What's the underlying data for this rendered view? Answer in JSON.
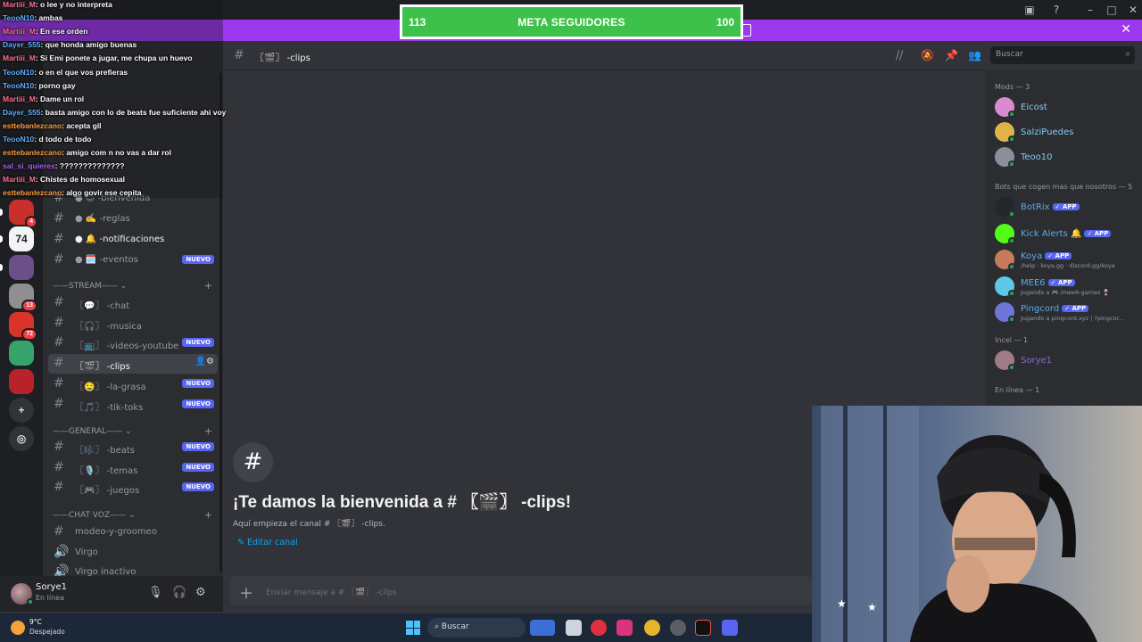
{
  "goal": {
    "left": "113",
    "label": "META SEGUIDORES",
    "right": "100"
  },
  "stream_chat": [
    {
      "user": "Martiii_M",
      "text": ": o lee y no interpreta",
      "color": "#ff6f91"
    },
    {
      "user": "TeooN10",
      "text": ": ambas",
      "color": "#5fb0ff"
    },
    {
      "user": "Martiii_M",
      "text": ": En ese orden",
      "color": "#ff6f91"
    },
    {
      "user": "Dayer_555",
      "text": ": que honda amigo buenas",
      "color": "#5fb0ff"
    },
    {
      "user": "Martiii_M",
      "text": ": Si Emi ponete a jugar, me chupa un huevo",
      "color": "#ff6f91"
    },
    {
      "user": "TeooN10",
      "text": ": o en el que vos prefieras",
      "color": "#5fb0ff"
    },
    {
      "user": "TeooN10",
      "text": ": porno gay",
      "color": "#5fb0ff"
    },
    {
      "user": "Martiii_M",
      "text": ": Dame un rol",
      "color": "#ff6f91"
    },
    {
      "user": "Dayer_555",
      "text": ": basta amigo con lo de beats fue suficiente ahi voy",
      "color": "#5fb0ff"
    },
    {
      "user": "esttebanlezcano",
      "text": ": acepta gil",
      "color": "#ff9f43"
    },
    {
      "user": "TeooN10",
      "text": ": d todo de todo",
      "color": "#5fb0ff"
    },
    {
      "user": "esttebanlezcano",
      "text": ": amigo com n no vas a dar rol",
      "color": "#ff9f43"
    },
    {
      "user": "sal_si_quieres",
      "text": ": ??????????????",
      "color": "#b35cff"
    },
    {
      "user": "Martiii_M",
      "text": ": Chistes de homosexual",
      "color": "#ff6f91"
    },
    {
      "user": "esttebanlezcano",
      "text": ": algo govir ese cepita",
      "color": "#ff9f43"
    }
  ],
  "servers": [
    {
      "label": "",
      "color": "#c9302c",
      "badge": "4"
    },
    {
      "label": "74",
      "color": "#f2f3f5",
      "badge": ""
    },
    {
      "label": "",
      "color": "#6b4e8a",
      "badge": ""
    },
    {
      "label": "",
      "color": "#8f8f8f",
      "badge": "13"
    },
    {
      "label": "",
      "color": "#d9342b",
      "badge": "72"
    },
    {
      "label": "",
      "color": "#35a36b",
      "badge": ""
    },
    {
      "label": "",
      "color": "#b8232b",
      "badge": ""
    }
  ],
  "rail_actions": {
    "add": "+",
    "discover": "◎"
  },
  "sidebar": {
    "top_channels": [
      {
        "name": "● 😊 -bienvenida",
        "nuevo": ""
      },
      {
        "name": "● ✍️ -reglas",
        "nuevo": ""
      },
      {
        "name": "● 🔔 -notificaciones",
        "nuevo": ""
      },
      {
        "name": "● 🗓️ -eventos",
        "nuevo": "NUEVO"
      }
    ],
    "cat_stream": "——STREAM——  ⌄",
    "stream_channels": [
      {
        "name": "〖💬〗 -chat",
        "nuevo": ""
      },
      {
        "name": "〖🎧〗 -musica",
        "nuevo": ""
      },
      {
        "name": "〖📺〗 -videos-youtube",
        "nuevo": "NUEVO"
      },
      {
        "name": "〖🎬〗 -clips",
        "nuevo": ""
      },
      {
        "name": "〖🤤〗 -la-grasa",
        "nuevo": "NUEVO"
      },
      {
        "name": "〖🎵〗 -tik-toks",
        "nuevo": "NUEVO"
      }
    ],
    "cat_general": "——GENERAL——  ⌄",
    "general_channels": [
      {
        "name": "〖🎼〗 -beats",
        "nuevo": "NUEVO"
      },
      {
        "name": "〖🎙️〗 -temas",
        "nuevo": "NUEVO"
      },
      {
        "name": "〖🎮〗 -juegos",
        "nuevo": "NUEVO"
      }
    ],
    "cat_voice": "——CHAT VOZ——  ⌄",
    "voice_channels": [
      {
        "name": "modeo-y-groomeo",
        "icon": "#"
      },
      {
        "name": "Virgo",
        "icon": "🔊"
      },
      {
        "name": "Virgo inactivo",
        "icon": "🔊"
      }
    ]
  },
  "user": {
    "name": "Sorye1",
    "status": "En línea"
  },
  "channel": {
    "name": "〖🎬〗 -clips",
    "welcome_title": "¡Te damos la bienvenida a # 〖🎬〗 -clips!",
    "welcome_sub": "Aquí empieza el canal # 〖🎬〗 -clips.",
    "edit": "Editar canal",
    "composer_placeholder": "Enviar mensaje a # 〖🎬〗 -clips"
  },
  "search_placeholder": "Buscar",
  "members": {
    "mods_header": "Mods — 3",
    "mods": [
      {
        "name": "Eicost",
        "color": "#85c9f2",
        "av": "#d98ad0"
      },
      {
        "name": "SalziPuedes",
        "color": "#85c9f2",
        "av": "#e0b24a"
      },
      {
        "name": "Teoo10",
        "color": "#85c9f2",
        "av": "#8a8f99"
      }
    ],
    "bots_header": "Bots que cogen mas que nosotros — 5",
    "bots": [
      {
        "name": "BotRix",
        "app": "✓ APP",
        "activity": "",
        "av": "#23262b"
      },
      {
        "name": "Kick Alerts 🔔",
        "app": "✓ APP",
        "activity": "",
        "av": "#53fc18"
      },
      {
        "name": "Koya",
        "app": "✓ APP",
        "activity": "/help · koya.gg · discord.gg/koya",
        "av": "#c97a5b"
      },
      {
        "name": "MEE6",
        "app": "✓ APP",
        "activity": "Jugando a 🎮 /mee6-games 🍷",
        "av": "#5dc9e8"
      },
      {
        "name": "Pingcord",
        "app": "✓ APP",
        "activity": "Jugando a pingcord.xyz | ?pingcor...",
        "av": "#6f76d9"
      }
    ],
    "incel_header": "Incel — 1",
    "incel": [
      {
        "name": "Sorye1",
        "av": "#a07a86"
      }
    ],
    "online_header": "En línea — 1"
  },
  "taskbar": {
    "temp": "9°C",
    "condition": "Despejado",
    "search": "Buscar"
  }
}
